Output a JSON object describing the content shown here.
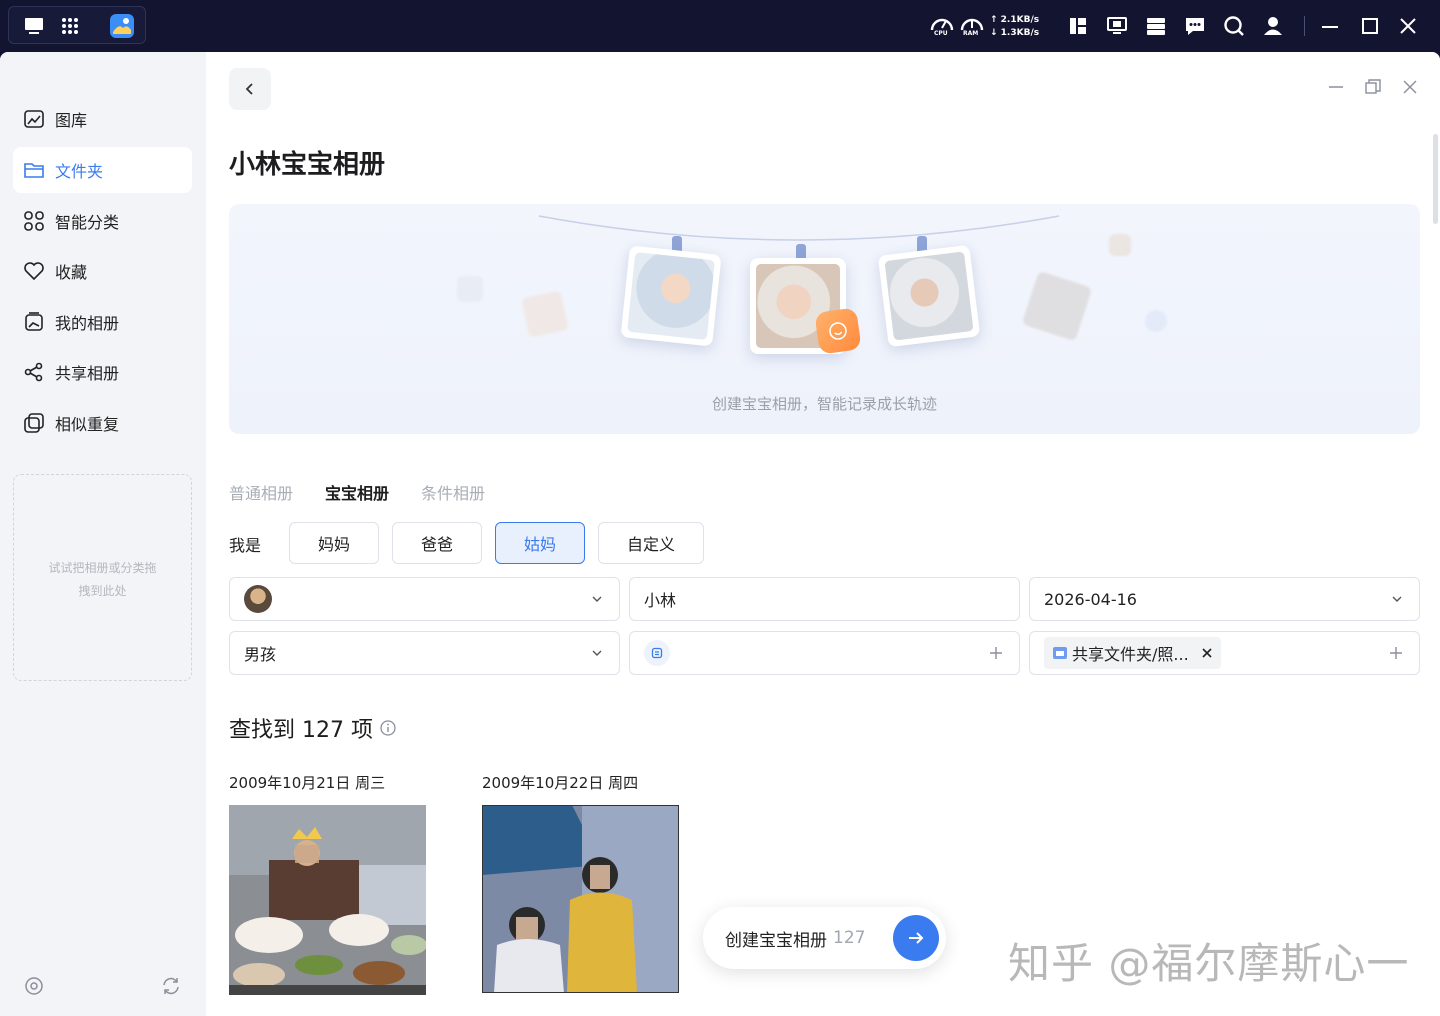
{
  "osbar": {
    "cpu_label": "CPU",
    "ram_label": "RAM",
    "upload": "↑ 2.1KB/s",
    "download": "↓ 1.3KB/s"
  },
  "sidebar": {
    "items": [
      {
        "label": "图库",
        "icon": "gallery-icon"
      },
      {
        "label": "文件夹",
        "icon": "folder-icon"
      },
      {
        "label": "智能分类",
        "icon": "grid-icon"
      },
      {
        "label": "收藏",
        "icon": "heart-icon"
      },
      {
        "label": "我的相册",
        "icon": "album-icon"
      },
      {
        "label": "共享相册",
        "icon": "share-icon"
      },
      {
        "label": "相似重复",
        "icon": "duplicate-icon"
      }
    ],
    "active_index": 1,
    "dropzone_line1": "试试把相册或分类拖",
    "dropzone_line2": "拽到此处"
  },
  "main": {
    "title": "小林宝宝相册",
    "hero_caption": "创建宝宝相册，智能记录成长轨迹",
    "tabs": [
      {
        "label": "普通相册",
        "active": false
      },
      {
        "label": "宝宝相册",
        "active": true
      },
      {
        "label": "条件相册",
        "active": false
      }
    ],
    "role_label": "我是",
    "roles": [
      {
        "label": "妈妈",
        "active": false
      },
      {
        "label": "爸爸",
        "active": false
      },
      {
        "label": "姑妈",
        "active": true
      },
      {
        "label": "自定义",
        "active": false
      }
    ],
    "form": {
      "name_value": "小林",
      "birth_date": "2026-04-16",
      "gender": "男孩",
      "folder_chip": "共享文件夹/照..."
    },
    "found_text": "查找到 127 项",
    "groups": [
      {
        "date": "2009年10月21日 周三"
      },
      {
        "date": "2009年10月22日 周四"
      }
    ],
    "create_button": "创建宝宝相册",
    "create_count": "127"
  },
  "watermark": "知乎 @福尔摩斯心一",
  "colors": {
    "accent": "#3a7bf0",
    "os_bar": "#13142f",
    "sidebar_bg": "#f2f4f7"
  }
}
